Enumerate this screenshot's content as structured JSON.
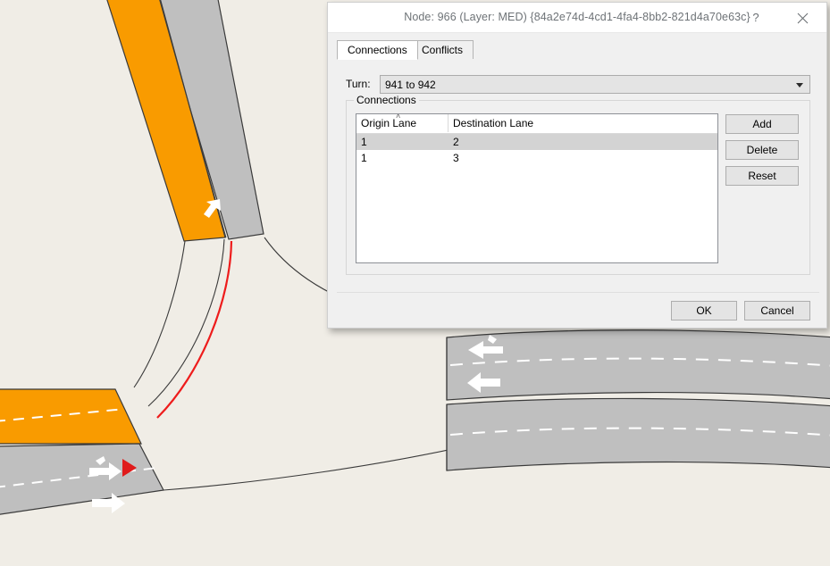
{
  "dialog": {
    "title": "Node: 966 (Layer: MED) {84a2e74d-4cd1-4fa4-8bb2-821d4a70e63c}",
    "help_label": "?",
    "close_icon": "close-icon",
    "tabs": [
      {
        "label": "Connections",
        "selected": true
      },
      {
        "label": "Conflicts",
        "selected": false
      }
    ],
    "turn": {
      "label": "Turn:",
      "value": "941 to 942",
      "dropdown_icon": "chevron-down-icon"
    },
    "group": {
      "legend": "Connections",
      "table": {
        "columns": [
          "Origin Lane",
          "Destination Lane"
        ],
        "sort_column": "Origin Lane",
        "sort_indicator": "˄",
        "rows": [
          {
            "origin": "1",
            "destination": "2",
            "selected": true
          },
          {
            "origin": "1",
            "destination": "3",
            "selected": false
          }
        ]
      },
      "buttons": [
        {
          "label": "Add"
        },
        {
          "label": "Delete"
        },
        {
          "label": "Reset"
        }
      ]
    },
    "footer_buttons": [
      {
        "label": "OK"
      },
      {
        "label": "Cancel"
      }
    ]
  },
  "map": {
    "background_color": "#f0ede6",
    "lane_highlight_color": "#f99b00",
    "road_color": "#bfbfbf",
    "road_color_light": "#c4c4c4",
    "outline_color": "#3a3a3a",
    "connector_highlight_color": "#ee1c1c",
    "lane_marking_color": "#ffffff",
    "selected_marker_color": "#e01b1b",
    "markers": [
      {
        "name": "lane-direction-arrow-northwest",
        "type": "arrow"
      },
      {
        "name": "lane-direction-arrow-east-merge",
        "type": "arrow"
      },
      {
        "name": "lane-direction-arrow-east",
        "type": "arrow"
      },
      {
        "name": "lane-direction-arrow-west-merge",
        "type": "arrow"
      },
      {
        "name": "lane-direction-arrow-west",
        "type": "arrow"
      },
      {
        "name": "selected-node-marker",
        "type": "triangle"
      }
    ]
  }
}
